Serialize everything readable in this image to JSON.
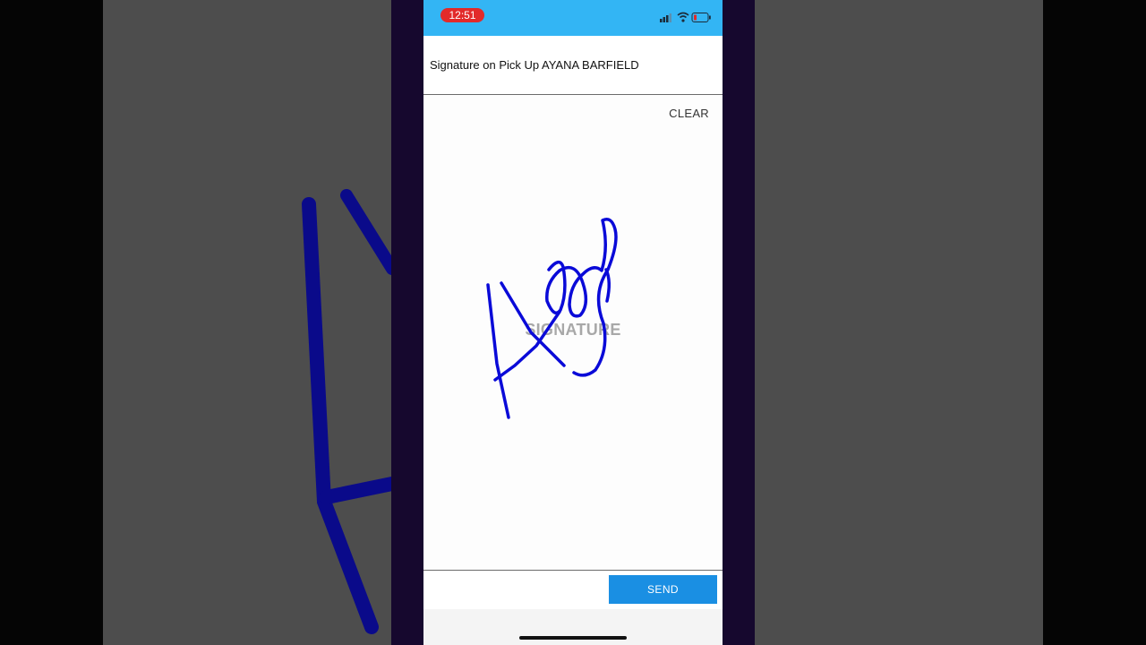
{
  "status_bar": {
    "time": "12:51",
    "bg_color": "#33b5f4",
    "time_pill_color": "#e22a2a",
    "icons": [
      "signal-icon",
      "wifi-icon",
      "battery-low-icon"
    ]
  },
  "header": {
    "title": "Signature on Pick Up AYANA BARFIELD"
  },
  "signature_pad": {
    "clear_label": "CLEAR",
    "placeholder": "SIGNATURE",
    "ink_color": "#0a0ad8"
  },
  "footer": {
    "send_label": "SEND",
    "send_color": "#1a8fe3"
  }
}
